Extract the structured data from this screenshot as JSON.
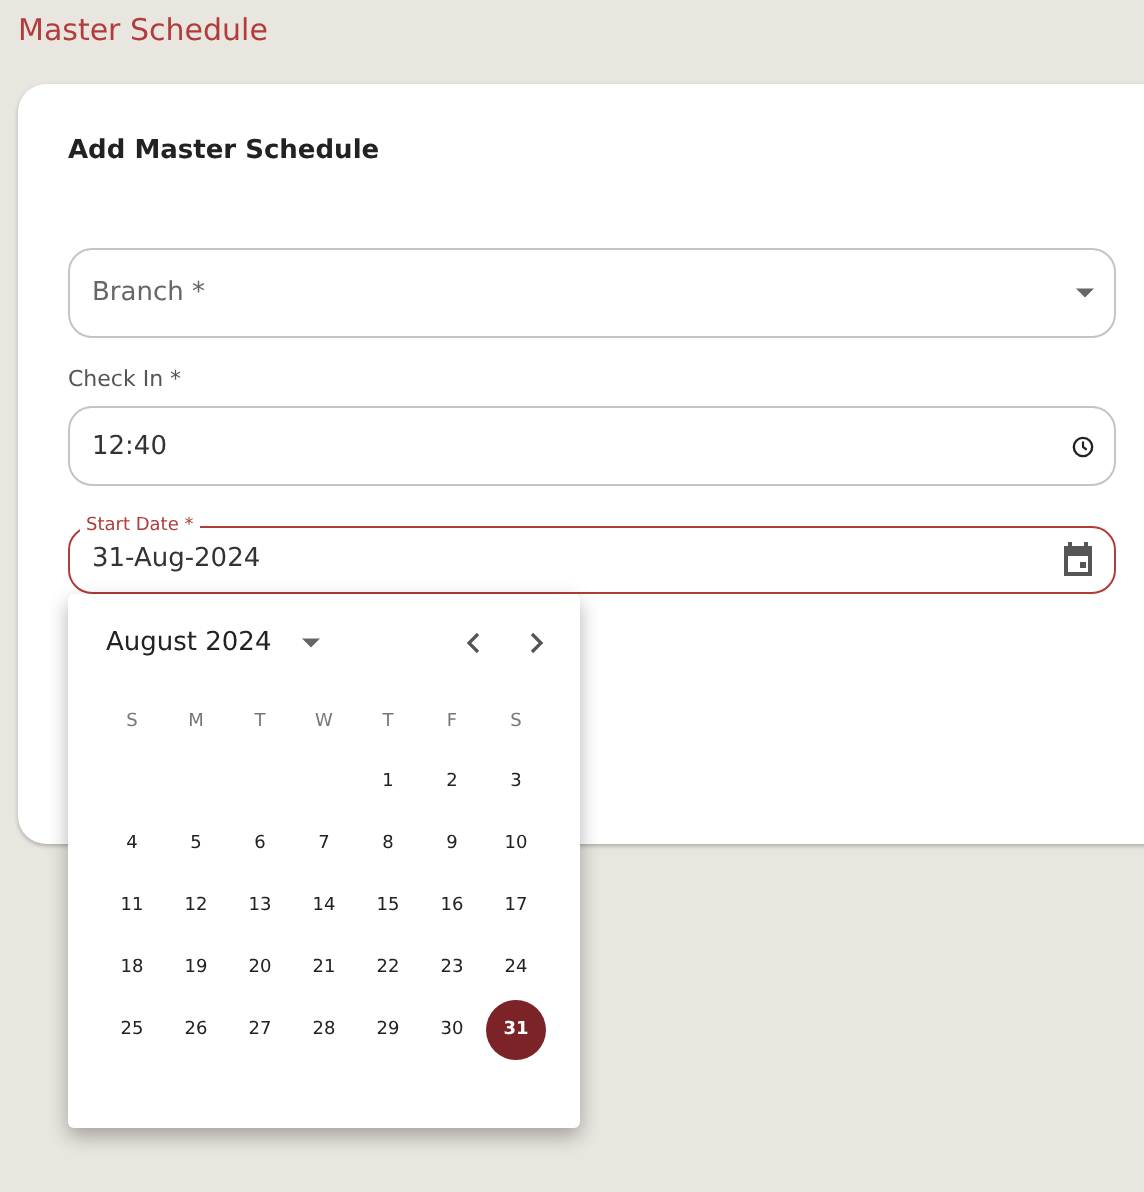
{
  "page_title": "Master Schedule",
  "form": {
    "title": "Add Master Schedule",
    "branch": {
      "placeholder": "Branch *"
    },
    "check_in": {
      "label": "Check In *",
      "value": "12:40"
    },
    "start_date": {
      "label": "Start Date *",
      "value": "31-Aug-2024",
      "focused": true
    }
  },
  "calendar": {
    "month": "August 2024",
    "weekdays": [
      "S",
      "M",
      "T",
      "W",
      "T",
      "F",
      "S"
    ],
    "weeks": [
      {
        "days": [
          {
            "day": "1",
            "selected": false
          },
          {
            "day": "2",
            "selected": false
          },
          {
            "day": "3",
            "selected": false
          }
        ]
      },
      {
        "days": [
          {
            "day": "4",
            "selected": false
          },
          {
            "day": "5",
            "selected": false
          },
          {
            "day": "6",
            "selected": false
          },
          {
            "day": "7",
            "selected": false
          },
          {
            "day": "8",
            "selected": false
          },
          {
            "day": "9",
            "selected": false
          },
          {
            "day": "10",
            "selected": false
          }
        ]
      },
      {
        "days": [
          {
            "day": "11",
            "selected": false
          },
          {
            "day": "12",
            "selected": false
          },
          {
            "day": "13",
            "selected": false
          },
          {
            "day": "14",
            "selected": false
          },
          {
            "day": "15",
            "selected": false
          },
          {
            "day": "16",
            "selected": false
          },
          {
            "day": "17",
            "selected": false
          }
        ]
      },
      {
        "days": [
          {
            "day": "18",
            "selected": false
          },
          {
            "day": "19",
            "selected": false
          },
          {
            "day": "20",
            "selected": false
          },
          {
            "day": "21",
            "selected": false
          },
          {
            "day": "22",
            "selected": false
          },
          {
            "day": "23",
            "selected": false
          },
          {
            "day": "24",
            "selected": false
          }
        ]
      },
      {
        "days": [
          {
            "day": "25",
            "selected": false
          },
          {
            "day": "26",
            "selected": false
          },
          {
            "day": "27",
            "selected": false
          },
          {
            "day": "28",
            "selected": false
          },
          {
            "day": "29",
            "selected": false
          },
          {
            "day": "30",
            "selected": false
          },
          {
            "day": "31",
            "selected": true
          }
        ]
      }
    ]
  }
}
